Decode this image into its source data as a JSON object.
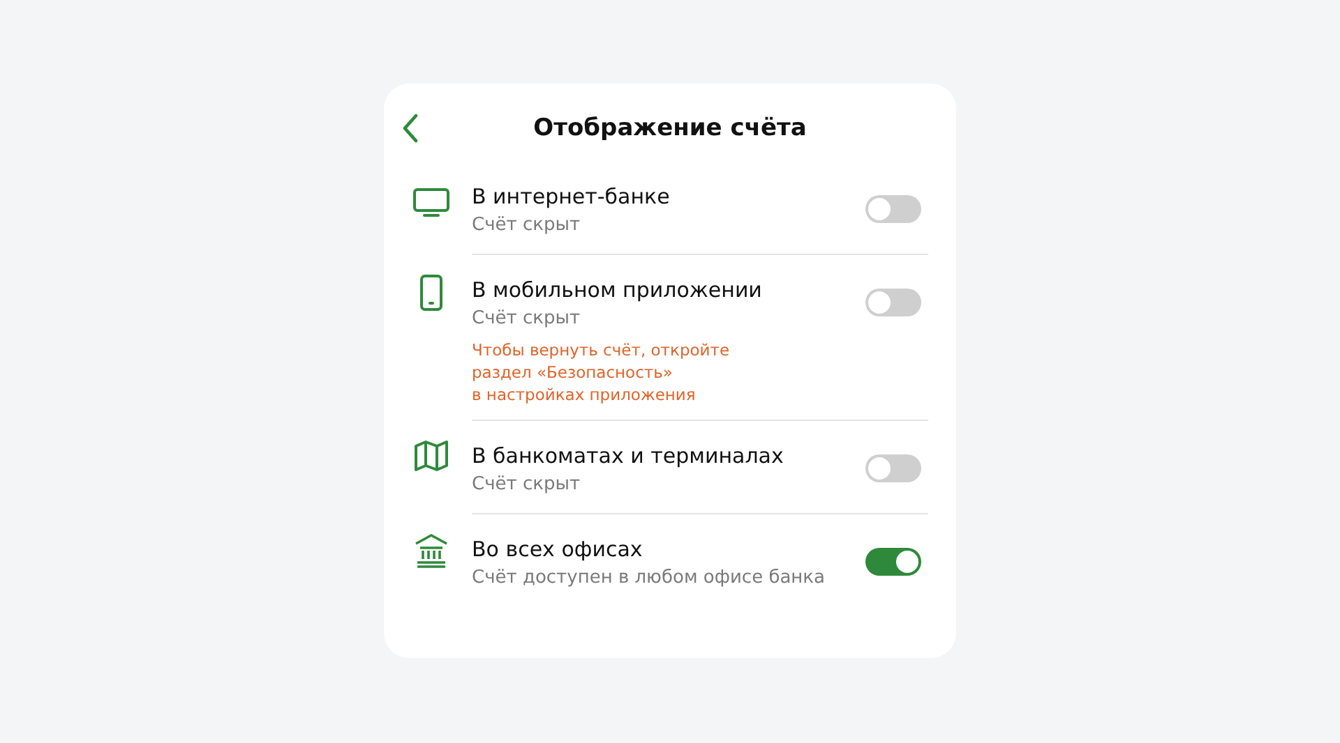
{
  "header": {
    "title": "Отображение счёта"
  },
  "settings": [
    {
      "kind": "monitor",
      "label": "В интернет-банке",
      "status": "Счёт скрыт",
      "on": false
    },
    {
      "kind": "phone",
      "label": "В мобильном приложении",
      "status": "Счёт скрыт",
      "note": "Чтобы вернуть счёт, откройте\nраздел «Безопасность»\nв настройках приложения",
      "on": false
    },
    {
      "kind": "map",
      "label": "В банкоматах и терминалах",
      "status": "Счёт скрыт",
      "on": false
    },
    {
      "kind": "bank",
      "label": "Во всех офисах",
      "status": "Счёт доступен в любом офисе банка",
      "on": true
    }
  ]
}
